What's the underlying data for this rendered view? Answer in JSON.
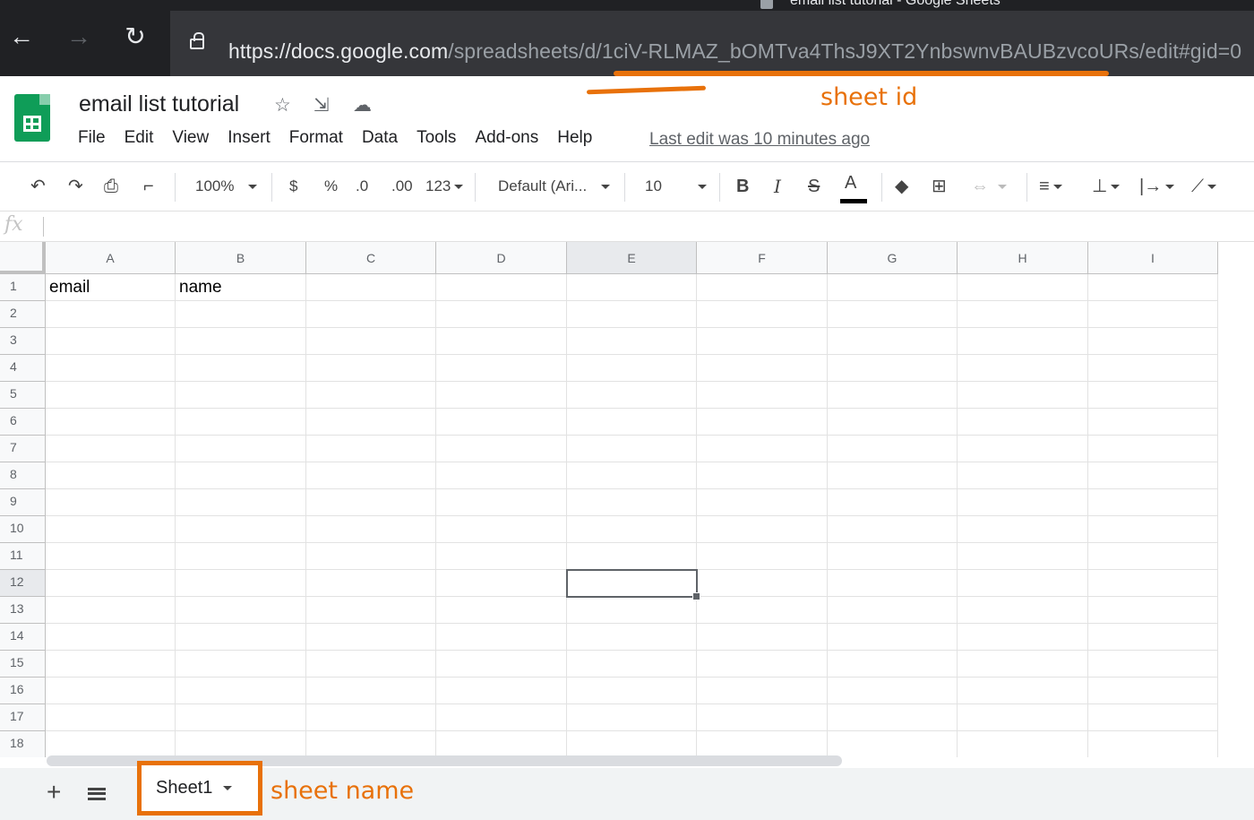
{
  "browser": {
    "tab_title": "email list tutorial - Google Sheets",
    "back_icon": "←",
    "forward_icon": "→",
    "reload_icon": "↻",
    "url_host": "https://docs.google.com",
    "url_path": "/spreadsheets/d/1ciV-RLMAZ_bOMTva4ThsJ9XT2YnbswnvBAUBzvcoURs/edit#gid=0"
  },
  "doc": {
    "title": "email list tutorial",
    "star_icon": "☆",
    "move_icon": "⇲",
    "cloud_icon": "☁",
    "menu": [
      "File",
      "Edit",
      "View",
      "Insert",
      "Format",
      "Data",
      "Tools",
      "Add-ons",
      "Help"
    ],
    "last_edit": "Last edit was 10 minutes ago"
  },
  "annotations": {
    "sheet_id": "sheet id",
    "sheet_name": "sheet name",
    "accent_color": "#e8710a"
  },
  "toolbar": {
    "undo": "↶",
    "redo": "↷",
    "print": "⎙",
    "paint": "⌐",
    "zoom": "100%",
    "currency": "$",
    "percent": "%",
    "dec_decrease": ".0",
    "dec_increase": ".00",
    "more_formats": "123",
    "font": "Default (Ari...",
    "font_size": "10",
    "bold": "B",
    "italic": "I",
    "strike": "S",
    "text_color": "A",
    "fill": "◆",
    "borders": "⊞",
    "merge": "⇔",
    "h_align": "≡",
    "v_align": "⊥",
    "wrap": "|→",
    "rotate": "⟋"
  },
  "formula": {
    "fx": "fx",
    "value": ""
  },
  "grid": {
    "columns": [
      "A",
      "B",
      "C",
      "D",
      "E",
      "F",
      "G",
      "H",
      "I"
    ],
    "rows": [
      "1",
      "2",
      "3",
      "4",
      "5",
      "6",
      "7",
      "8",
      "9",
      "10",
      "11",
      "12",
      "13",
      "14",
      "15",
      "16",
      "17",
      "18"
    ],
    "cells": {
      "A1": "email",
      "B1": "name"
    },
    "selected": "E12"
  },
  "sheets": {
    "add_icon": "+",
    "list_icon": "list-icon",
    "tabs": [
      "Sheet1"
    ]
  }
}
